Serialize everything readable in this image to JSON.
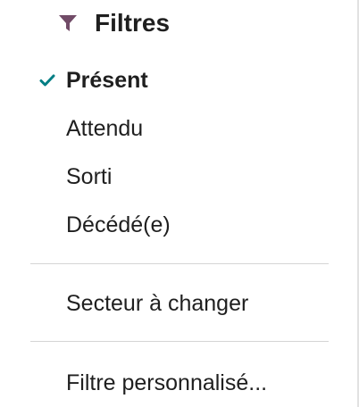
{
  "header": {
    "title": "Filtres",
    "icon": "filter-icon",
    "icon_color": "#714B67"
  },
  "filters": [
    {
      "label": "Présent",
      "checked": true
    },
    {
      "label": "Attendu",
      "checked": false
    },
    {
      "label": "Sorti",
      "checked": false
    },
    {
      "label": "Décédé(e)",
      "checked": false
    }
  ],
  "group2": [
    {
      "label": "Secteur à changer",
      "checked": false
    }
  ],
  "custom_filter": {
    "label": "Filtre personnalisé..."
  },
  "colors": {
    "check": "#017E84",
    "text": "#1f1f1f",
    "divider": "#d5d5d5"
  }
}
